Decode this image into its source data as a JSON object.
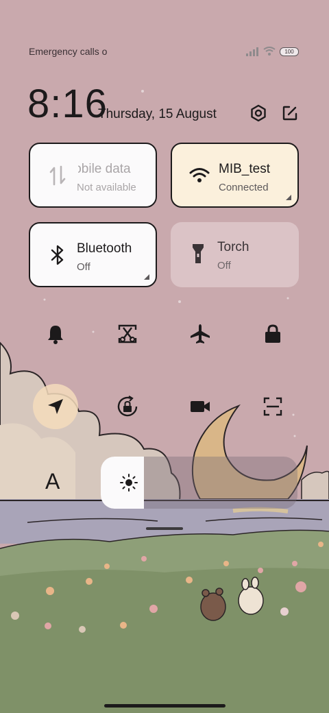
{
  "status_bar": {
    "carrier_text": "Emergency calls o",
    "battery_level": "100",
    "icons": [
      "signal-icon",
      "wifi-icon",
      "battery-icon"
    ]
  },
  "header": {
    "time": "8:16",
    "date": "Thursday, 15 August",
    "icons": [
      "settings-icon",
      "edit-icon"
    ]
  },
  "tiles": {
    "mobile_data": {
      "title": "Mobile data",
      "title_visible": "lobile data",
      "subtitle": "Not available"
    },
    "wifi": {
      "title": "MIB_test",
      "subtitle": "Connected"
    },
    "bluetooth": {
      "title": "Bluetooth",
      "subtitle": "Off"
    },
    "torch": {
      "title": "Torch",
      "subtitle": "Off"
    }
  },
  "toggles_row1": [
    "bell-icon",
    "screenshot-cut-icon",
    "airplane-icon",
    "lock-icon"
  ],
  "toggles_row2": [
    "location-icon",
    "rotation-lock-icon",
    "video-camera-icon",
    "scan-icon"
  ],
  "brightness": {
    "auto_label": "A",
    "level": 0.22
  },
  "colors": {
    "sky": "#c9a9ad",
    "tile_active": "#fbf0dc",
    "tile_default": "#fbfafb",
    "location_active": "#f4dcbc",
    "text": "#1c1a1b"
  }
}
